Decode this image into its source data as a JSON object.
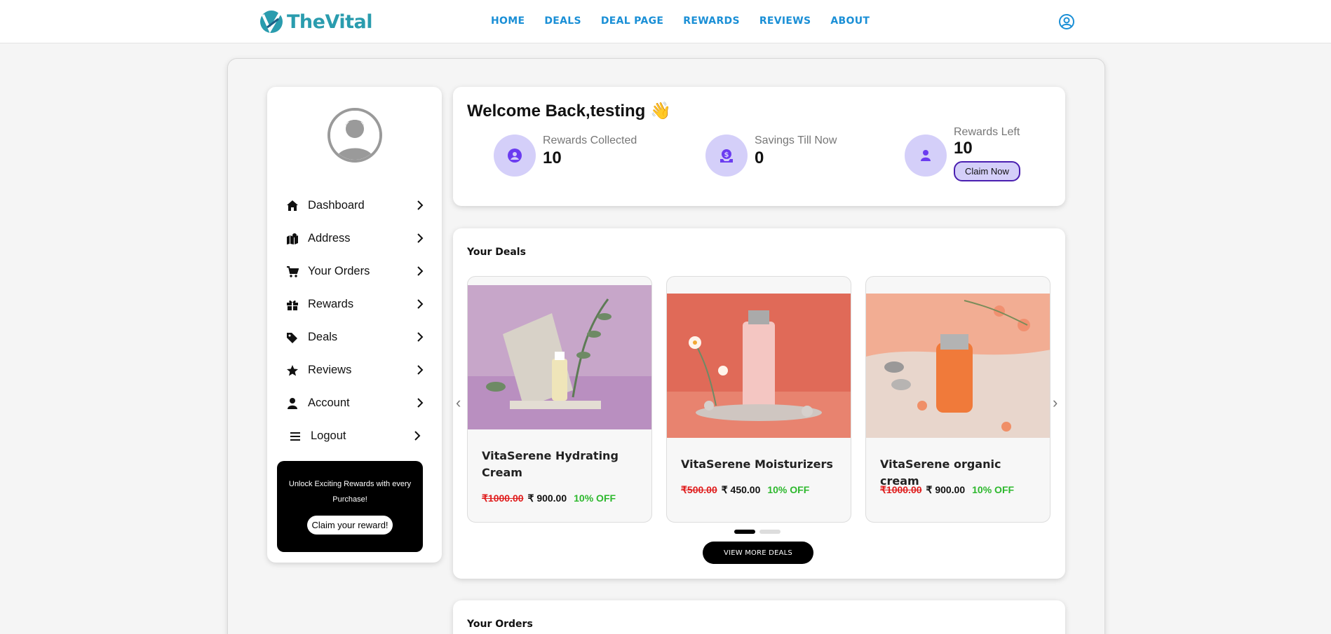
{
  "brand": {
    "name": "TheVital",
    "color": "#2a9cae"
  },
  "nav": {
    "items": [
      "HOME",
      "DEALS",
      "DEAL PAGE",
      "REWARDS",
      "REVIEWS",
      "ABOUT"
    ]
  },
  "sidebar": {
    "items": [
      {
        "label": "Dashboard",
        "icon": "home-icon"
      },
      {
        "label": "Address",
        "icon": "map-icon"
      },
      {
        "label": "Your Orders",
        "icon": "cart-icon"
      },
      {
        "label": "Rewards",
        "icon": "gift-icon"
      },
      {
        "label": "Deals",
        "icon": "tags-icon"
      },
      {
        "label": "Reviews",
        "icon": "star-icon"
      },
      {
        "label": "Account",
        "icon": "user-icon"
      },
      {
        "label": "Logout",
        "icon": "bars-icon"
      }
    ],
    "promo": {
      "text": "Unlock Exciting Rewards with every Purchase!",
      "button": "Claim your reward!"
    }
  },
  "welcome": {
    "title": "Welcome Back,testing 👋",
    "stats": [
      {
        "label": "Rewards Collected",
        "value": "10"
      },
      {
        "label": "Savings Till Now",
        "value": "0"
      },
      {
        "label": "Rewards Left",
        "value": "10",
        "button": "Claim Now"
      }
    ]
  },
  "deals": {
    "title": "Your Deals",
    "items": [
      {
        "name": "VitaSerene Hydrating Cream",
        "old_price": "₹1000.00",
        "new_price": "₹ 900.00",
        "off": "10% OFF"
      },
      {
        "name": "VitaSerene Moisturizers",
        "old_price": "₹500.00",
        "new_price": "₹ 450.00",
        "off": "10% OFF"
      },
      {
        "name": "VitaSerene organic cream",
        "old_price": "₹1000.00",
        "new_price": "₹ 900.00",
        "off": "10% OFF"
      }
    ],
    "prev": "‹",
    "next": "›",
    "view_more": "VIEW MORE DEALS"
  },
  "orders": {
    "title": "Your Orders"
  },
  "colors": {
    "accent": "#1a8fd6",
    "stat_bg": "#d4cff9",
    "purple": "#4a1fb0",
    "discount": "#2db82d",
    "old_price": "#e01e1e"
  }
}
